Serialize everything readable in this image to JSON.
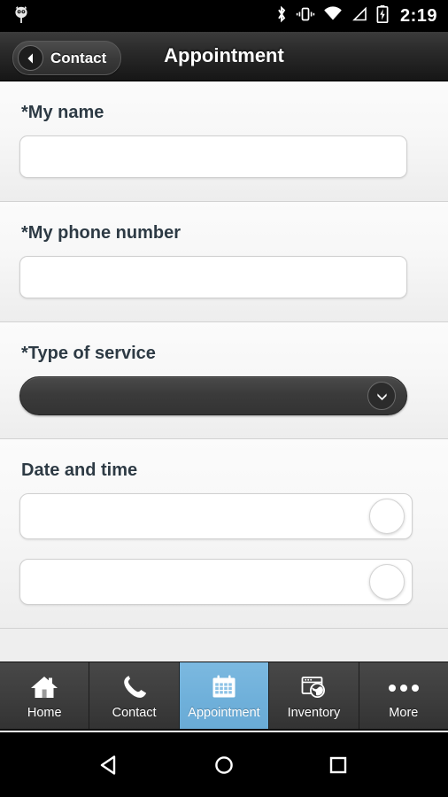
{
  "statusbar": {
    "notification_icon": "owl-notification-icon",
    "icons": [
      "bluetooth-icon",
      "vibrate-icon",
      "wifi-icon",
      "signal-icon",
      "battery-charging-icon"
    ],
    "clock": "2:19"
  },
  "header": {
    "back_label": "Contact",
    "back_icon": "chevron-left-icon",
    "title": "Appointment"
  },
  "form": {
    "fields": [
      {
        "label": "*My name",
        "type": "text",
        "value": "",
        "placeholder": ""
      },
      {
        "label": "*My phone number",
        "type": "text",
        "value": "",
        "placeholder": ""
      },
      {
        "label": "*Type of service",
        "type": "select",
        "value": "",
        "chevron_icon": "chevron-down-icon"
      },
      {
        "label": "Date and time",
        "type": "datetime",
        "date_value": "",
        "date_placeholder": "",
        "time_value": "",
        "time_placeholder": "",
        "picker_icon": "circle-picker-icon"
      }
    ]
  },
  "tabbar": {
    "active": "Appointment",
    "items": [
      {
        "label": "Home",
        "icon": "home-icon"
      },
      {
        "label": "Contact",
        "icon": "phone-icon"
      },
      {
        "label": "Appointment",
        "icon": "calendar-icon"
      },
      {
        "label": "Inventory",
        "icon": "browser-globe-icon"
      },
      {
        "label": "More",
        "icon": "ellipsis-icon"
      }
    ]
  },
  "navbar": {
    "back": "back-triangle-icon",
    "home": "home-circle-icon",
    "recents": "recents-square-icon"
  },
  "colors": {
    "accent": "#6fb0da",
    "titlebar": "#2a2a2a",
    "tabbar": "#3d3d3d",
    "label_text": "#2d3a44"
  }
}
